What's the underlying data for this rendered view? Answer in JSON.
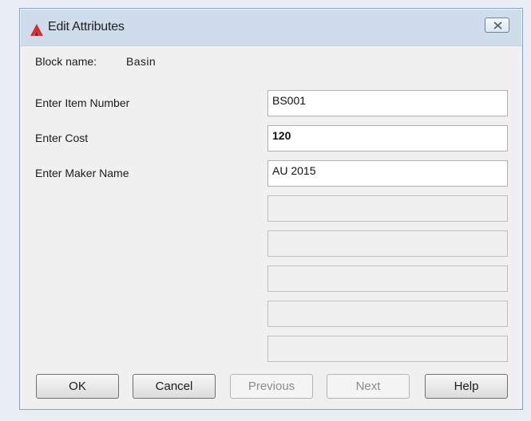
{
  "window": {
    "title": "Edit Attributes",
    "icon": "autocad-a-icon",
    "close_icon": "close-icon"
  },
  "block": {
    "label": "Block name:",
    "value": "Basin"
  },
  "attributes": [
    {
      "prompt": "Enter Item Number",
      "value": "BS001"
    },
    {
      "prompt": "Enter Cost",
      "value": "120"
    },
    {
      "prompt": "Enter Maker Name",
      "value": "AU 2015"
    }
  ],
  "empty_fields_count": 5,
  "buttons": {
    "ok": "OK",
    "cancel": "Cancel",
    "previous": "Previous",
    "next": "Next",
    "help": "Help"
  },
  "colors": {
    "title_bar": "#cfdceb",
    "client_area": "#f0f0f0",
    "app_icon_red": "#d32f2f"
  }
}
